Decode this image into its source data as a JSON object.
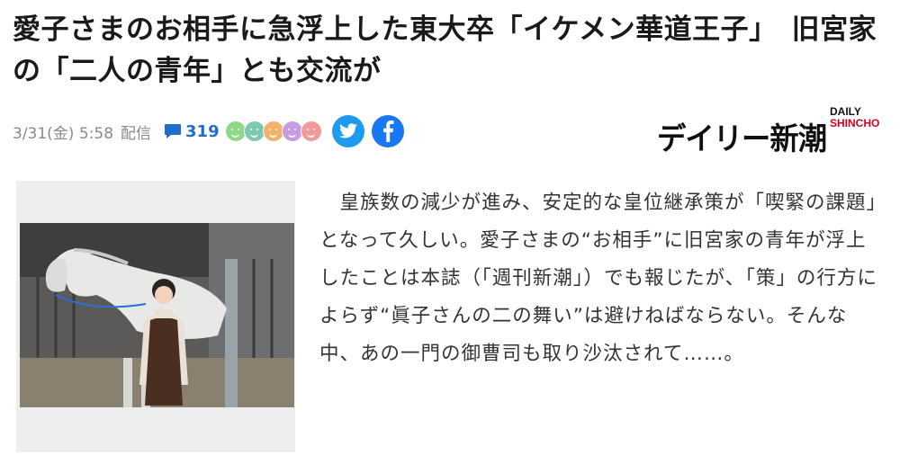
{
  "headline": "愛子さまのお相手に急浮上した東大卒「イケメン華道王子」　旧宮家の「二人の青年」とも交流が",
  "meta": {
    "date": "3/31(金) 5:58",
    "distribution": "配信",
    "comment_count": "319"
  },
  "reaction_colors": [
    "#8fd88a",
    "#7cc9b0",
    "#f2b26a",
    "#c99be0",
    "#f29a9a"
  ],
  "icons": {
    "comment": "comment-icon",
    "twitter": "twitter-icon",
    "facebook": "facebook-icon"
  },
  "publisher": {
    "logo_ja": "デイリー新潮",
    "logo_en_top": "DAILY",
    "logo_en_bottom": "SHINCHO"
  },
  "photo": {
    "description_icon": "photo-image"
  },
  "article": {
    "body": "　皇族数の減少が進み、安定的な皇位継承策が「喫緊の課題」となって久しい。愛子さまの“お相手”に旧宮家の青年が浮上したことは本誌（「週刊新潮」）でも報じたが、「策」の行方によらず“眞子さんの二の舞い”は避けねばならない。そんな中、あの一門の御曹司も取り沙汰されて……。"
  }
}
